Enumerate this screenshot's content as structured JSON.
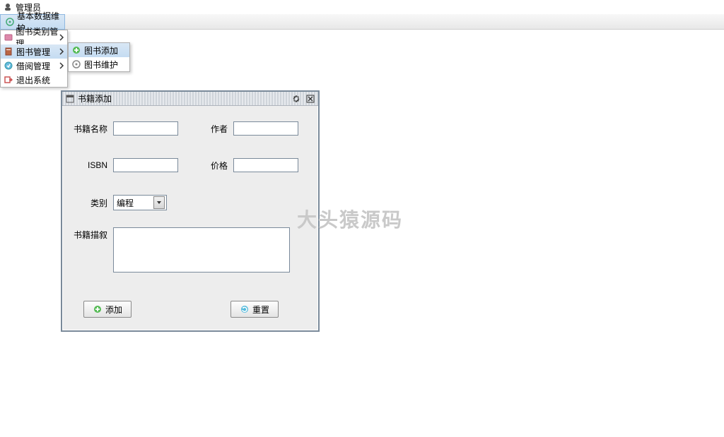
{
  "app": {
    "title": "管理员"
  },
  "menubar": {
    "item_label": "基本数据维护"
  },
  "dropdown_lvl1": {
    "items": [
      {
        "label": "图书类别管理",
        "icon": "category-icon"
      },
      {
        "label": "图书管理",
        "icon": "book-icon"
      },
      {
        "label": "借阅管理",
        "icon": "borrow-icon"
      },
      {
        "label": "退出系统",
        "icon": "exit-icon"
      }
    ]
  },
  "dropdown_lvl2": {
    "items": [
      {
        "label": "图书添加",
        "icon": "add-icon"
      },
      {
        "label": "图书维护",
        "icon": "maintain-icon"
      }
    ]
  },
  "dialog": {
    "title": "书籍添加",
    "labels": {
      "name": "书籍名称",
      "author": "作者",
      "isbn": "ISBN",
      "price": "价格",
      "category": "类别",
      "description": "书籍描叙"
    },
    "values": {
      "name": "",
      "author": "",
      "isbn": "",
      "price": "",
      "category": "编程",
      "description": ""
    },
    "buttons": {
      "add": "添加",
      "reset": "重置"
    }
  },
  "watermark": "大头猿源码"
}
